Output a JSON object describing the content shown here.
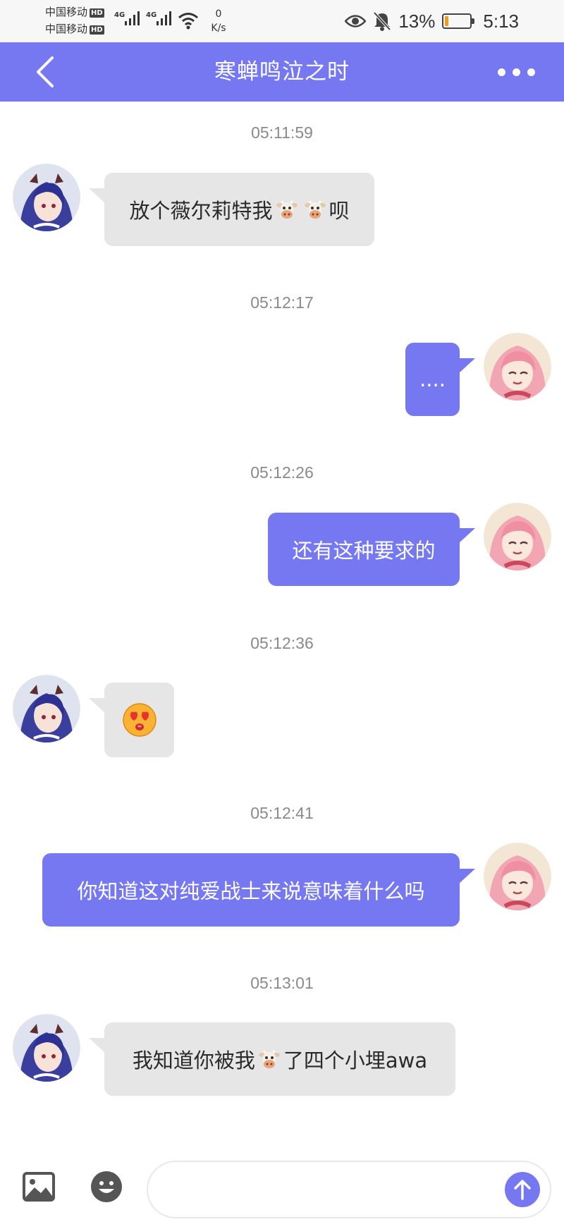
{
  "status_bar": {
    "carrier_1": "中国移动",
    "carrier_2": "中国移动",
    "hd_badge": "HD",
    "network_1": "4G",
    "network_2": "4G",
    "net_speed_value": "0",
    "net_speed_unit": "K/s",
    "battery_percent": "13%",
    "battery_level": 0.13,
    "battery_color": "#f39a1c",
    "time": "5:13",
    "icons": [
      "eye-icon",
      "mute-bell-icon",
      "battery-icon",
      "wifi-icon",
      "signal-icon"
    ]
  },
  "header": {
    "title": "寒蝉鸣泣之时",
    "back_icon": "chevron-left-icon",
    "more_icon": "more-dots-icon",
    "color": "#7678f2"
  },
  "messages": [
    {
      "time": "05:11:59",
      "side": "left",
      "text_parts": [
        "放个薇尔莉特我",
        "cow-emoji",
        "cow-emoji",
        "呗"
      ]
    },
    {
      "time": "05:12:17",
      "side": "right",
      "text": "...."
    },
    {
      "time": "05:12:26",
      "side": "right",
      "text": "还有这种要求的"
    },
    {
      "time": "05:12:36",
      "side": "left",
      "emoji": "heart-eyes-kiss-emoji"
    },
    {
      "time": "05:12:41",
      "side": "right",
      "text": "你知道这对纯爱战士来说意味着什么吗"
    },
    {
      "time": "05:13:01",
      "side": "left",
      "text_parts": [
        "我知道你被我",
        "cow-emoji",
        "了四个小埋awa"
      ]
    }
  ],
  "bottom_bar": {
    "image_icon": "image-icon",
    "emoji_icon": "smiley-icon",
    "input_value": "",
    "send_icon": "arrow-up-icon"
  }
}
